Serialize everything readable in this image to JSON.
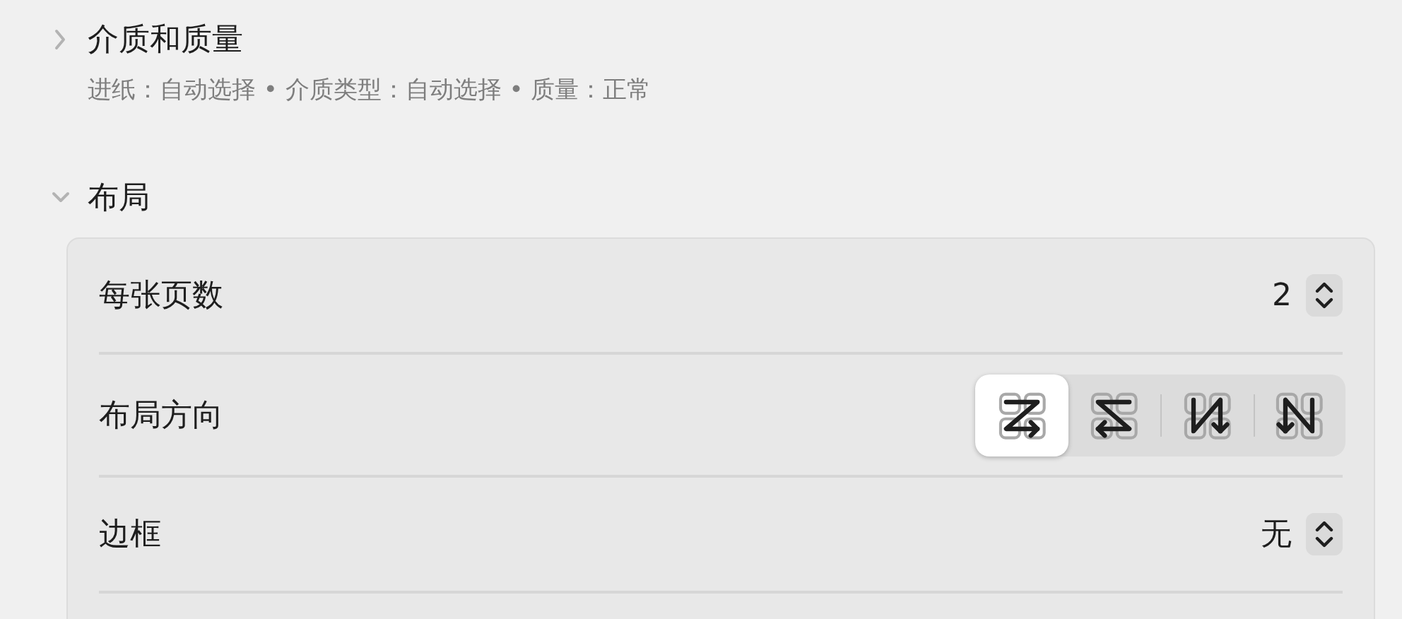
{
  "sections": [
    {
      "title": "介质和质量",
      "expanded": false,
      "summary": "进纸：自动选择 • 介质类型：自动选择 • 质量：正常"
    },
    {
      "title": "布局",
      "expanded": true,
      "rows": [
        {
          "kind": "stepper",
          "label": "每张页数",
          "value": "2"
        },
        {
          "kind": "segmented",
          "label": "布局方向",
          "options": [
            {
              "kind": "z",
              "selected": true
            },
            {
              "kind": "reverse-z",
              "selected": false
            },
            {
              "kind": "reverse-n",
              "selected": false
            },
            {
              "kind": "n",
              "selected": false
            }
          ]
        },
        {
          "kind": "stepper",
          "label": "边框",
          "value": "无"
        }
      ]
    }
  ]
}
